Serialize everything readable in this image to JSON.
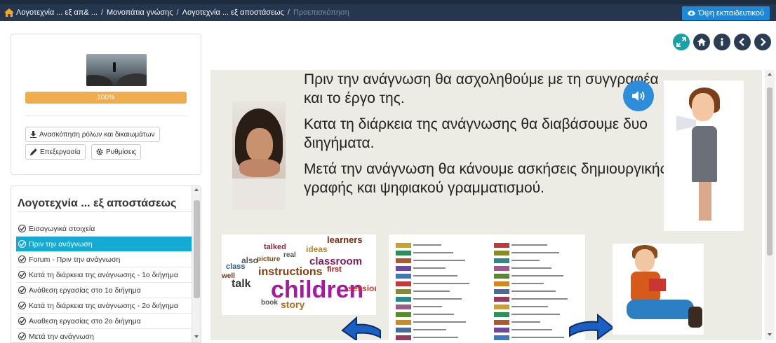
{
  "breadcrumb": {
    "items": [
      "Λογοτεχνία ... εξ απ& ...",
      "Μονοπάτια γνώσης",
      "Λογοτεχνία ... εξ αποστάσεως"
    ],
    "current": "Προεπισκόπηση",
    "separator": "/"
  },
  "header": {
    "teacher_view_label": "Όψη εκπαιδευτικού"
  },
  "course_card": {
    "progress_label": "100%",
    "progress": 1.0,
    "review_roles_label": "Ανασκόπηση ρόλων και δικαιωμάτων",
    "edit_label": "Επεξεργασία",
    "settings_label": "Ρυθμίσεις"
  },
  "toc": {
    "title": "Λογοτεχνία ... εξ αποστάσεως",
    "items": [
      {
        "label": "Εισαγωγικά στοιχεία"
      },
      {
        "label": "Πριν την ανάγνωση",
        "active": true
      },
      {
        "label": "Forum - Πριν την ανάγνωση"
      },
      {
        "label": "Κατά τη διάρκεια της ανάγνωσης - 1ο διήγημα"
      },
      {
        "label": "Ανάθεση εργασίας στο 1ο διήγημα"
      },
      {
        "label": "Κατά τη διάρκεια της ανάγνωσης - 2ο διήγημα"
      },
      {
        "label": "Αναθεση εργασίας στο 2ο διήγημα"
      },
      {
        "label": "Μετά την ανάγνωση"
      }
    ]
  },
  "nav_icons": [
    "expand-icon",
    "home-icon",
    "info-icon",
    "chevron-left-icon",
    "chevron-right-icon"
  ],
  "content": {
    "paragraphs": [
      "Πριν την ανάγνωση θα ασχοληθούμε με τη συγγραφέα και το έργο της.",
      "Κατα τη διάρκεια της ανάγνωσης θα διαβάσουμε δυο διηγήματα.",
      "Μετά την ανάγνωση θα κάνουμε ασκήσεις δημιουργικής γραφής και ψηφιακού γραμματισμού."
    ],
    "wordcloud_words": [
      "children",
      "instructions",
      "classroom",
      "talk",
      "story",
      "ideas",
      "session",
      "learners",
      "also",
      "class",
      "well",
      "picture",
      "book",
      "first",
      "talked",
      "real"
    ]
  },
  "colors": {
    "topbar": "#24374f",
    "teacher_button": "#1e88d8",
    "progress": "#f0ad4e",
    "toc_active": "#14aad4",
    "nav_icon": "#2b3d52",
    "expand_icon": "#1aa1a6",
    "content_bg": "#ecebe4",
    "audio_button": "#2e8ddb"
  }
}
